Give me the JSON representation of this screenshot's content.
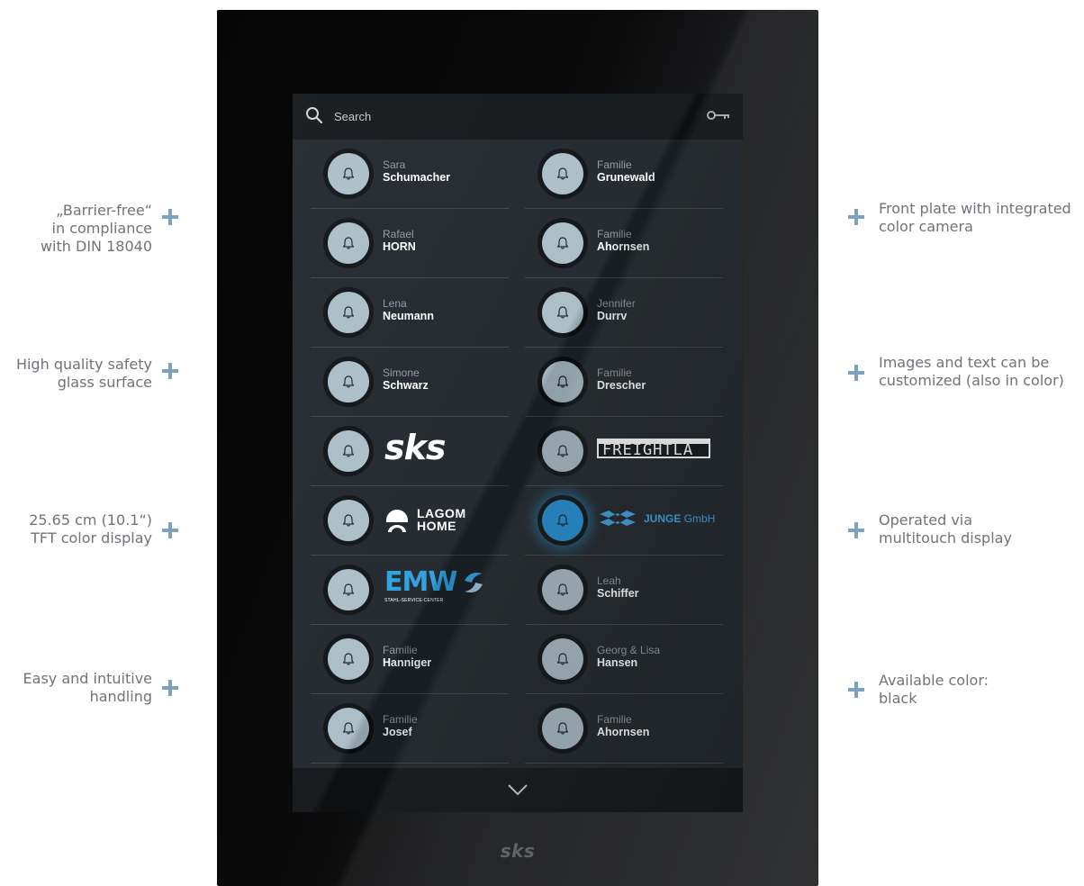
{
  "features": {
    "left": [
      {
        "text": "„Barrier-free“\nin compliance\nwith DIN 18040"
      },
      {
        "text": "High quality safety\nglass surface"
      },
      {
        "text": "25.65 cm (10.1“)\nTFT color display"
      },
      {
        "text": "Easy and intuitive\nhandling"
      }
    ],
    "right": [
      {
        "text": "Front plate with integrated\ncolor camera"
      },
      {
        "text": "Images and text can be\ncustomized (also in color)"
      },
      {
        "text": "Operated via\nmultitouch display"
      },
      {
        "text": "Available color:\nblack"
      }
    ]
  },
  "device": {
    "brand": "sks"
  },
  "search": {
    "placeholder": "Search"
  },
  "icons": {
    "search": "search-icon",
    "key": "key-icon",
    "bell": "bell-icon",
    "chevron": "chevron-down-icon"
  },
  "colors": {
    "accent": "#1e8fd4",
    "bell": "#a9bcc6",
    "plus": "#7aa3c2"
  },
  "residents": {
    "left": [
      {
        "first": "Sara",
        "last": "Schumacher"
      },
      {
        "first": "Rafael",
        "last": "HORN"
      },
      {
        "first": "Lena",
        "last": "Neumann"
      },
      {
        "first": "Simone",
        "last": "Schwarz"
      },
      {
        "logo": "sks"
      },
      {
        "logo": "LAGOM\nHOME"
      },
      {
        "logo": "EMW",
        "logo_sub": "STAHL-SERVICE-CENTER"
      },
      {
        "first": "Familie",
        "last": "Hanniger"
      },
      {
        "first": "Familie",
        "last": "Josef"
      }
    ],
    "right": [
      {
        "first": "Familie",
        "last": "Grunewald"
      },
      {
        "first": "Familie",
        "last": "Ahornsen"
      },
      {
        "first": "Jennifer",
        "last": "Durrv"
      },
      {
        "first": "Familie",
        "last": "Drescher"
      },
      {
        "logo": "FREIGHTLA"
      },
      {
        "logo_bold": "JUNGE",
        "logo_light": "GmbH",
        "active": true
      },
      {
        "first": "Leah",
        "last": "Schiffer"
      },
      {
        "first": "Georg & Lisa",
        "last": "Hansen"
      },
      {
        "first": "Familie",
        "last": "Ahornsen"
      }
    ]
  }
}
